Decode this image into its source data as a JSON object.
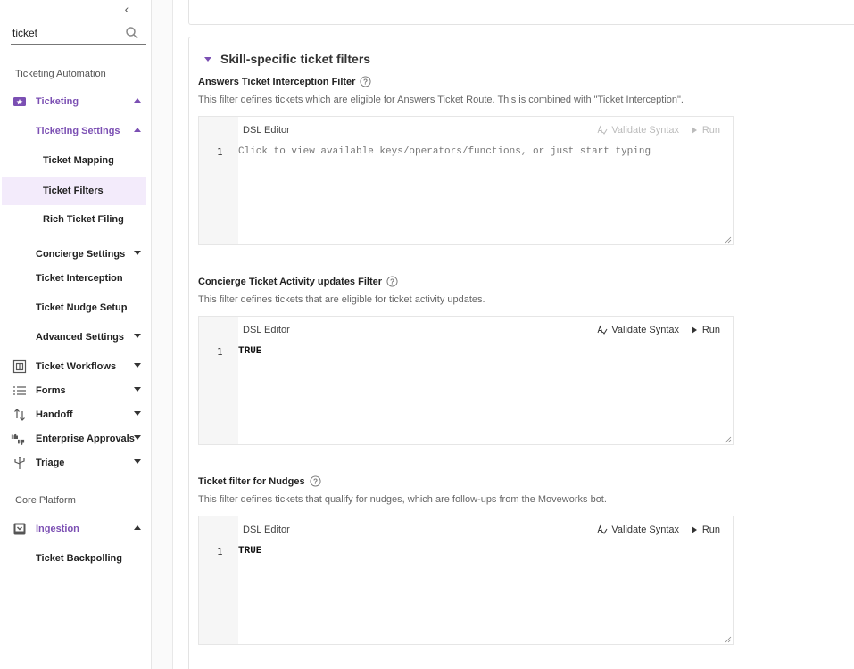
{
  "sidebar": {
    "collapse_glyph": "‹",
    "search": {
      "value": "ticket",
      "icon": "search-icon"
    },
    "sections": [
      {
        "label": "Ticketing Automation"
      },
      {
        "label": "Core Platform"
      }
    ],
    "items": {
      "ticketing": "Ticketing",
      "ticketing_settings": "Ticketing Settings",
      "ticket_mapping": "Ticket Mapping",
      "ticket_filters": "Ticket Filters",
      "rich_ticket_filing": "Rich Ticket Filing",
      "concierge_settings": "Concierge Settings",
      "ticket_interception": "Ticket Interception",
      "ticket_nudge_setup": "Ticket Nudge Setup",
      "advanced_settings": "Advanced Settings",
      "ticket_workflows": "Ticket Workflows",
      "forms": "Forms",
      "handoff": "Handoff",
      "enterprise_approvals": "Enterprise Approvals",
      "triage": "Triage",
      "ingestion": "Ingestion",
      "ticket_backpolling": "Ticket Backpolling"
    }
  },
  "main": {
    "section_title": "Skill-specific ticket filters",
    "filters": [
      {
        "title": "Answers Ticket Interception Filter",
        "description": "This filter defines tickets which are eligible for Answers Ticket Route. This is combined with \"Ticket Interception\".",
        "editor_label": "DSL Editor",
        "validate_label": "Validate Syntax",
        "run_label": "Run",
        "line_number": "1",
        "placeholder": "Click to view available keys/operators/functions, or just start typing",
        "value": ""
      },
      {
        "title": "Concierge Ticket Activity updates Filter",
        "description": "This filter defines tickets that are eligible for ticket activity updates.",
        "editor_label": "DSL Editor",
        "validate_label": "Validate Syntax",
        "run_label": "Run",
        "line_number": "1",
        "placeholder": "",
        "value": "TRUE"
      },
      {
        "title": "Ticket filter for Nudges",
        "description": "This filter defines tickets that qualify for nudges, which are follow-ups from the Moveworks bot.",
        "editor_label": "DSL Editor",
        "validate_label": "Validate Syntax",
        "run_label": "Run",
        "line_number": "1",
        "placeholder": "",
        "value": "TRUE"
      }
    ]
  },
  "colors": {
    "accent": "#7b4fb3",
    "active_bg": "#f3ebfb",
    "disabled": "#bbbbbb"
  }
}
